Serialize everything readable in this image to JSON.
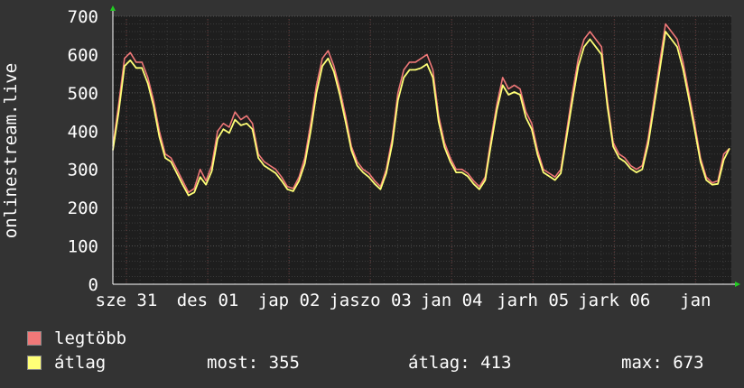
{
  "chart_data": {
    "type": "line",
    "ylabel": "onlinestream.live",
    "ylim": [
      0,
      700
    ],
    "yticks": [
      0,
      100,
      200,
      300,
      400,
      500,
      600,
      700
    ],
    "xticks": [
      "sze 31",
      "des 01",
      "jap 02",
      "jaszo 03",
      "jan 04",
      "jarh 05",
      "jark 06",
      "jan"
    ],
    "grid": true,
    "colors": {
      "background": "#333333",
      "plot": "#1e1e1e",
      "grid": "#4a4a4a",
      "max": "#f07878",
      "avg": "#ffff77",
      "axis": "#ffffff",
      "arrow": "#22cc22"
    },
    "series": [
      {
        "name": "legtöbb",
        "color": "#f07878",
        "values": [
          360,
          470,
          590,
          605,
          580,
          580,
          540,
          480,
          400,
          340,
          330,
          300,
          270,
          240,
          250,
          300,
          270,
          310,
          400,
          420,
          410,
          450,
          430,
          440,
          420,
          340,
          320,
          310,
          300,
          280,
          255,
          250,
          280,
          330,
          420,
          520,
          590,
          610,
          570,
          510,
          440,
          360,
          320,
          300,
          290,
          270,
          255,
          300,
          380,
          500,
          560,
          580,
          580,
          590,
          600,
          560,
          440,
          370,
          330,
          300,
          300,
          290,
          270,
          255,
          280,
          380,
          470,
          540,
          510,
          520,
          510,
          450,
          420,
          350,
          300,
          290,
          280,
          300,
          400,
          500,
          590,
          640,
          660,
          640,
          620,
          480,
          370,
          340,
          330,
          310,
          300,
          310,
          380,
          480,
          580,
          680,
          660,
          640,
          580,
          500,
          420,
          330,
          280,
          265,
          270,
          340,
          355
        ],
        "_note_removed": ""
      },
      {
        "name": "átlag",
        "color": "#ffff77",
        "values": [
          350,
          450,
          570,
          585,
          565,
          565,
          525,
          465,
          385,
          330,
          320,
          290,
          260,
          232,
          240,
          280,
          260,
          295,
          380,
          405,
          395,
          430,
          415,
          420,
          405,
          330,
          310,
          300,
          290,
          270,
          248,
          243,
          270,
          315,
          400,
          500,
          570,
          590,
          555,
          495,
          425,
          350,
          310,
          292,
          280,
          262,
          248,
          290,
          365,
          480,
          540,
          560,
          560,
          565,
          575,
          540,
          425,
          358,
          320,
          292,
          292,
          282,
          262,
          248,
          272,
          365,
          455,
          520,
          495,
          502,
          495,
          435,
          405,
          338,
          292,
          282,
          272,
          290,
          385,
          480,
          570,
          620,
          640,
          620,
          600,
          465,
          360,
          330,
          320,
          302,
          292,
          300,
          365,
          462,
          560,
          660,
          640,
          620,
          562,
          485,
          405,
          320,
          272,
          260,
          262,
          325,
          355
        ]
      }
    ],
    "legend": [
      {
        "label": "legtöbb",
        "color": "#f07878"
      },
      {
        "label": "átlag",
        "color": "#ffff77"
      }
    ],
    "stats": {
      "now_label": "most:",
      "now_value": "355",
      "avg_label": "átlag:",
      "avg_value": "413",
      "max_label": "max:",
      "max_value": "673"
    }
  }
}
